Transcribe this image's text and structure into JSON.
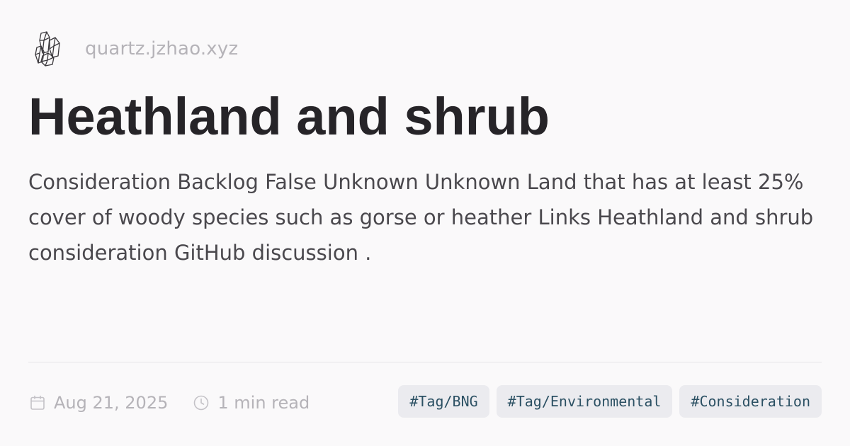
{
  "site": {
    "logo_icon": "crystal-cluster-icon",
    "name": "quartz.jzhao.xyz"
  },
  "article": {
    "title": "Heathland and shrub",
    "description": "Consideration Backlog False Unknown Unknown Land that has at least 25% cover of woody species such as gorse or heather Links Heathland and shrub consideration GitHub discussion ."
  },
  "meta": {
    "date_icon": "calendar-icon",
    "date": "Aug 21, 2025",
    "reading_icon": "clock-icon",
    "reading_time": "1 min read"
  },
  "tags": [
    "#Tag/BNG",
    "#Tag/Environmental",
    "#Consideration"
  ],
  "colors": {
    "background": "#faf9fa",
    "title": "#262428",
    "body_text": "#4a484d",
    "muted_text": "#b5b3b8",
    "tag_background": "#ebebef",
    "tag_text": "#2b5063",
    "divider": "#e6e4e7"
  }
}
